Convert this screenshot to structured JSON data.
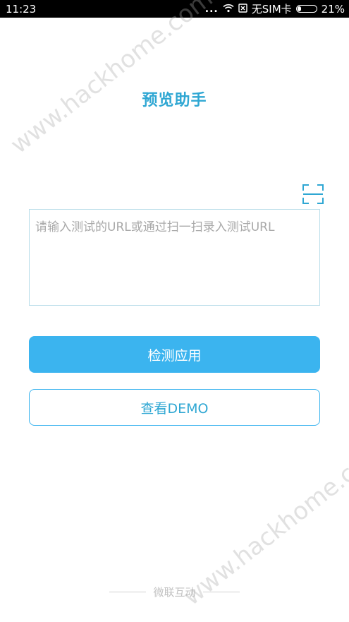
{
  "status_bar": {
    "time": "11:23",
    "signal_dots": "...",
    "carrier": "无SIM卡",
    "battery_text": "21%",
    "battery_level": 0.21
  },
  "app": {
    "title": "预览助手"
  },
  "url_input": {
    "placeholder": "请输入测试的URL或通过扫一扫录入测试URL",
    "value": ""
  },
  "buttons": {
    "check_app": "检测应用",
    "view_demo": "查看DEMO"
  },
  "footer": {
    "text": "微联互动"
  },
  "watermark": {
    "text": "www.hackhome.com"
  },
  "colors": {
    "accent": "#3bb4ef",
    "title": "#2fa7d3"
  }
}
